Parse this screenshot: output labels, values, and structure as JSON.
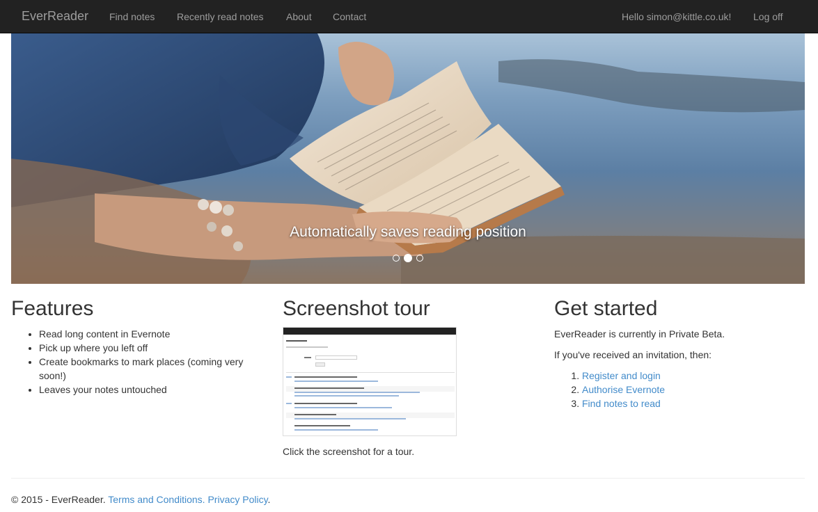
{
  "navbar": {
    "brand": "EverReader",
    "items": [
      {
        "label": "Find notes"
      },
      {
        "label": "Recently read notes"
      },
      {
        "label": "About"
      },
      {
        "label": "Contact"
      }
    ],
    "greeting": "Hello simon@kittle.co.uk!",
    "logoff": "Log off"
  },
  "carousel": {
    "caption": "Automatically saves reading position",
    "slides": 3,
    "active_slide": 2
  },
  "features": {
    "title": "Features",
    "items": [
      "Read long content in Evernote",
      "Pick up where you left off",
      "Create bookmarks to mark places (coming very soon!)",
      "Leaves your notes untouched"
    ]
  },
  "tour": {
    "title": "Screenshot tour",
    "caption": "Click the screenshot for a tour."
  },
  "get_started": {
    "title": "Get started",
    "intro": "EverReader is currently in Private Beta.",
    "invite": "If you've received an invitation, then:",
    "steps": [
      "Register and login",
      "Authorise Evernote",
      "Find notes to read"
    ]
  },
  "footer": {
    "copyright": "© 2015 - EverReader.",
    "terms": "Terms and Conditions.",
    "privacy": "Privacy Policy",
    "end": "."
  },
  "colors": {
    "navbar_bg": "#222222",
    "nav_text": "#9d9d9d",
    "link": "#428bca",
    "text": "#333333"
  }
}
